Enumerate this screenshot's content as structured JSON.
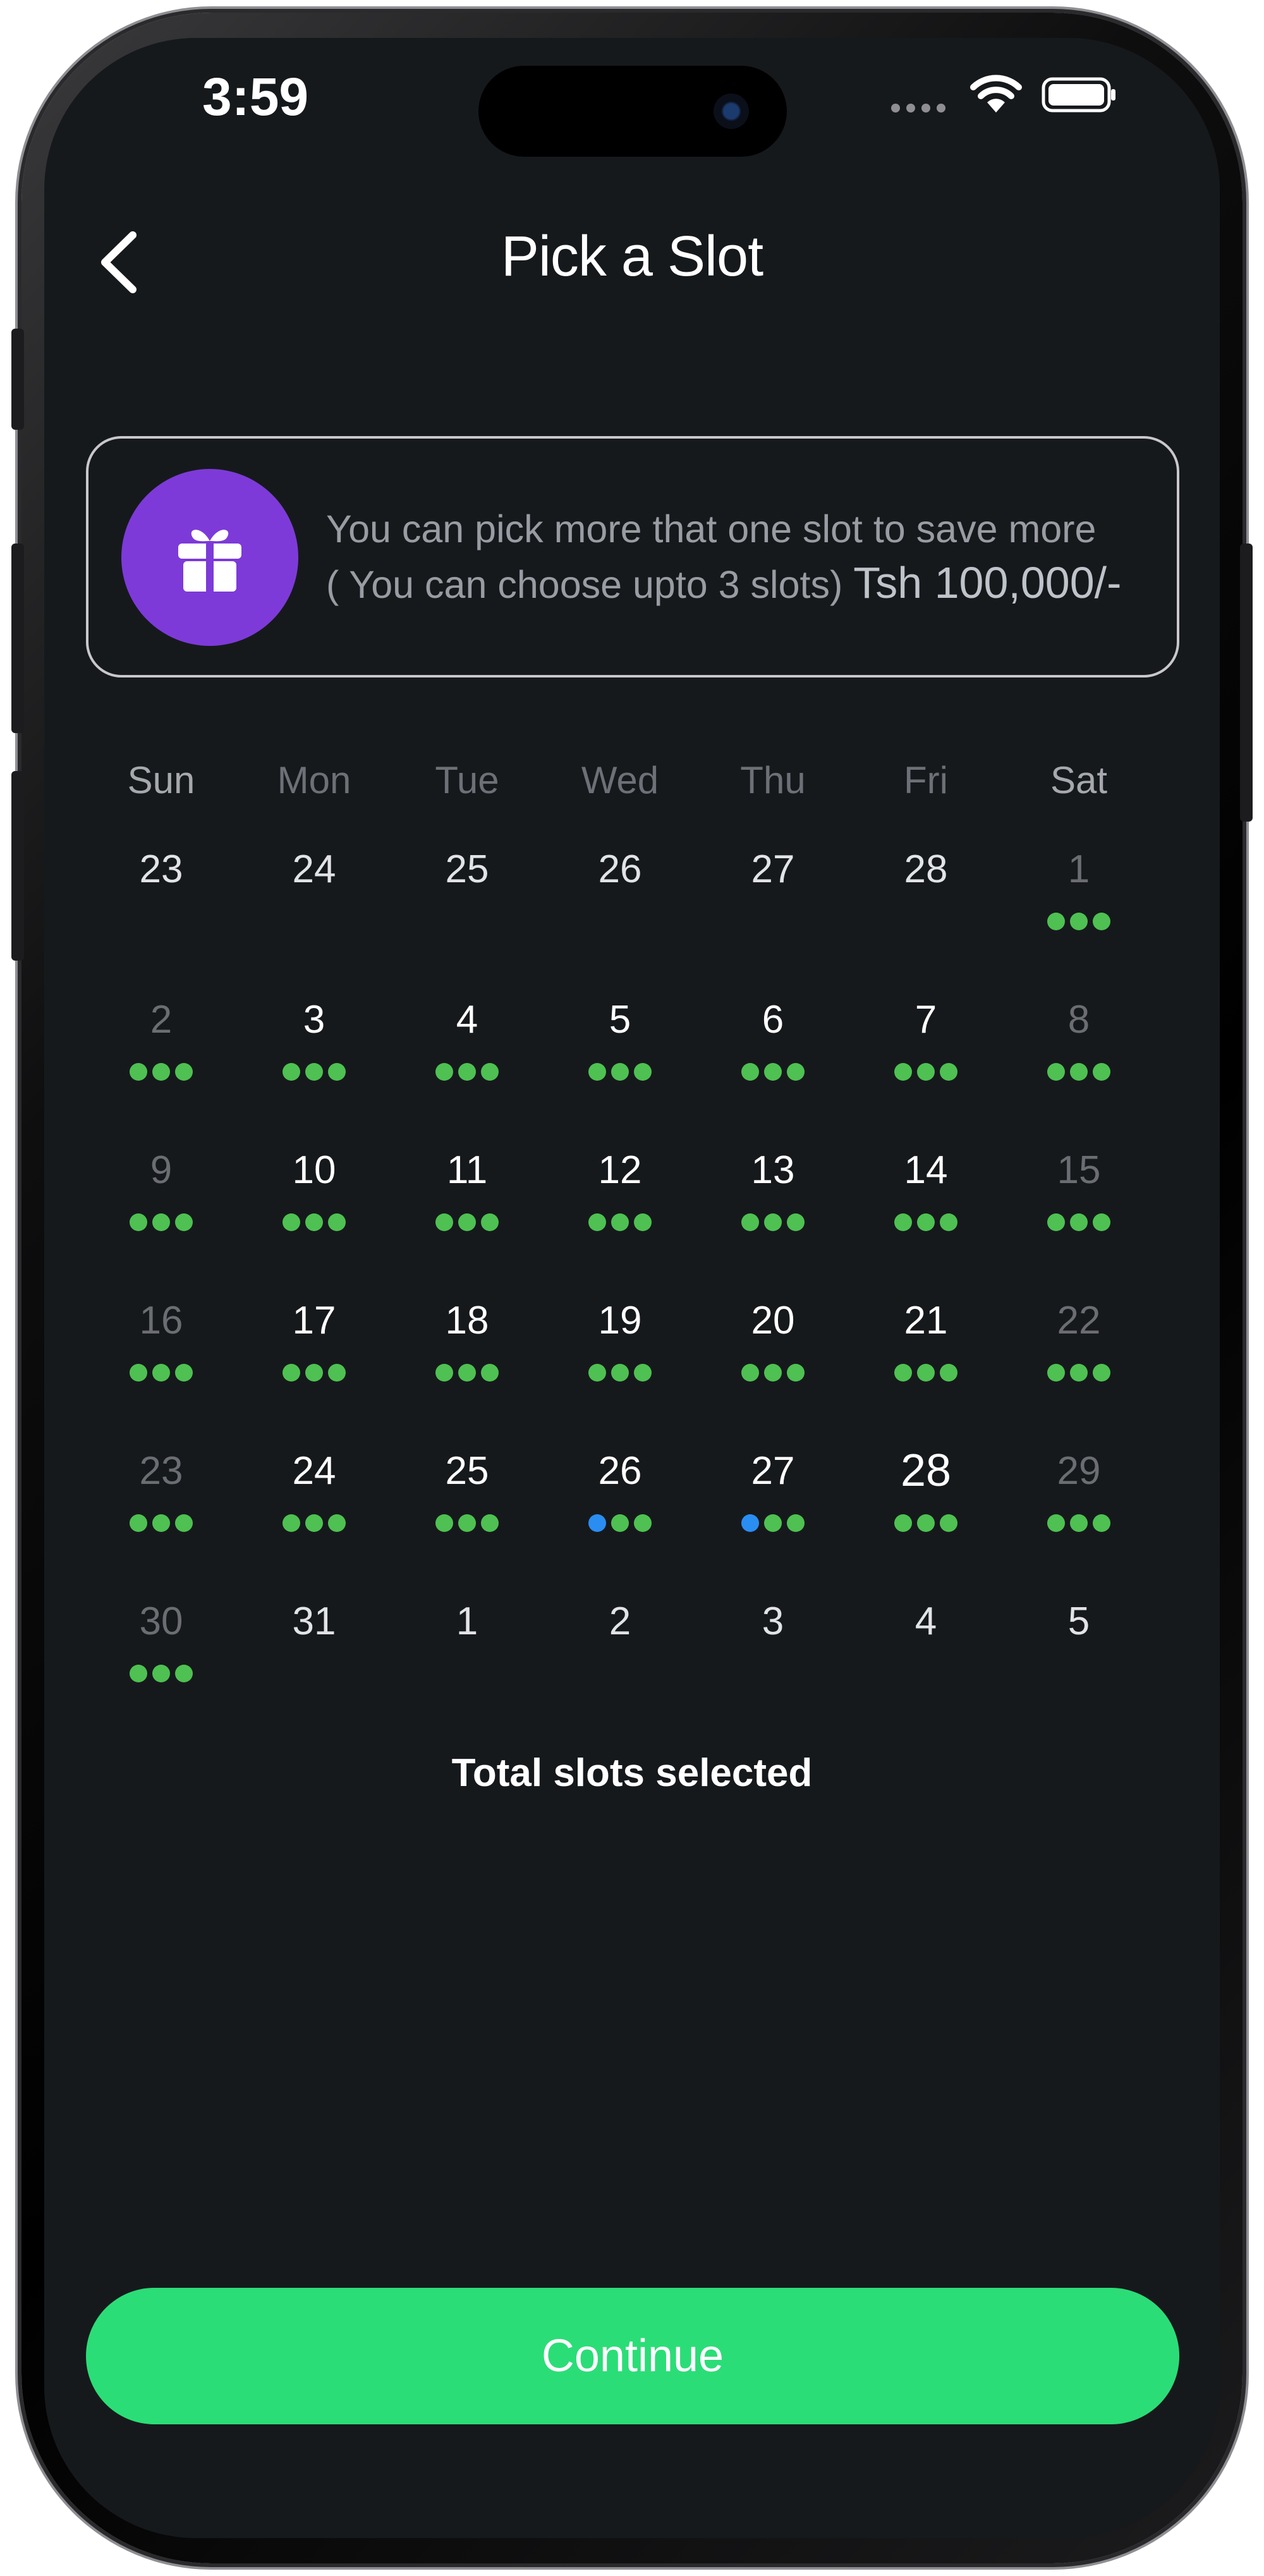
{
  "status_bar": {
    "time": "3:59"
  },
  "header": {
    "title": "Pick a Slot"
  },
  "promo": {
    "line1": "You can pick more that one slot to save more",
    "line2": "( You can choose upto 3 slots)",
    "price": "Tsh 100,000/-"
  },
  "weekdays": [
    "Sun",
    "Mon",
    "Tue",
    "Wed",
    "Thu",
    "Fri",
    "Sat"
  ],
  "calendar_rows": [
    [
      {
        "day": "23",
        "state": "plain",
        "dots": []
      },
      {
        "day": "24",
        "state": "plain",
        "dots": []
      },
      {
        "day": "25",
        "state": "plain",
        "dots": []
      },
      {
        "day": "26",
        "state": "plain",
        "dots": []
      },
      {
        "day": "27",
        "state": "plain",
        "dots": []
      },
      {
        "day": "28",
        "state": "plain",
        "dots": []
      },
      {
        "day": "1",
        "state": "dim",
        "dots": [
          "green",
          "green",
          "green"
        ]
      }
    ],
    [
      {
        "day": "2",
        "state": "dim",
        "dots": [
          "green",
          "green",
          "green"
        ]
      },
      {
        "day": "3",
        "state": "active",
        "dots": [
          "green",
          "green",
          "green"
        ]
      },
      {
        "day": "4",
        "state": "active",
        "dots": [
          "green",
          "green",
          "green"
        ]
      },
      {
        "day": "5",
        "state": "active",
        "dots": [
          "green",
          "green",
          "green"
        ]
      },
      {
        "day": "6",
        "state": "active",
        "dots": [
          "green",
          "green",
          "green"
        ]
      },
      {
        "day": "7",
        "state": "active",
        "dots": [
          "green",
          "green",
          "green"
        ]
      },
      {
        "day": "8",
        "state": "dim",
        "dots": [
          "green",
          "green",
          "green"
        ]
      }
    ],
    [
      {
        "day": "9",
        "state": "dim",
        "dots": [
          "green",
          "green",
          "green"
        ]
      },
      {
        "day": "10",
        "state": "active",
        "dots": [
          "green",
          "green",
          "green"
        ]
      },
      {
        "day": "11",
        "state": "active",
        "dots": [
          "green",
          "green",
          "green"
        ]
      },
      {
        "day": "12",
        "state": "active",
        "dots": [
          "green",
          "green",
          "green"
        ]
      },
      {
        "day": "13",
        "state": "active",
        "dots": [
          "green",
          "green",
          "green"
        ]
      },
      {
        "day": "14",
        "state": "active",
        "dots": [
          "green",
          "green",
          "green"
        ]
      },
      {
        "day": "15",
        "state": "dim",
        "dots": [
          "green",
          "green",
          "green"
        ]
      }
    ],
    [
      {
        "day": "16",
        "state": "dim",
        "dots": [
          "green",
          "green",
          "green"
        ]
      },
      {
        "day": "17",
        "state": "active",
        "dots": [
          "green",
          "green",
          "green"
        ]
      },
      {
        "day": "18",
        "state": "active",
        "dots": [
          "green",
          "green",
          "green"
        ]
      },
      {
        "day": "19",
        "state": "active",
        "dots": [
          "green",
          "green",
          "green"
        ]
      },
      {
        "day": "20",
        "state": "active",
        "dots": [
          "green",
          "green",
          "green"
        ]
      },
      {
        "day": "21",
        "state": "active",
        "dots": [
          "green",
          "green",
          "green"
        ]
      },
      {
        "day": "22",
        "state": "dim",
        "dots": [
          "green",
          "green",
          "green"
        ]
      }
    ],
    [
      {
        "day": "23",
        "state": "dim",
        "dots": [
          "green",
          "green",
          "green"
        ]
      },
      {
        "day": "24",
        "state": "active",
        "dots": [
          "green",
          "green",
          "green"
        ]
      },
      {
        "day": "25",
        "state": "active",
        "dots": [
          "green",
          "green",
          "green"
        ]
      },
      {
        "day": "26",
        "state": "active",
        "dots": [
          "blue",
          "green",
          "green"
        ]
      },
      {
        "day": "27",
        "state": "active",
        "dots": [
          "blue",
          "green",
          "green"
        ]
      },
      {
        "day": "28",
        "state": "today",
        "dots": [
          "green",
          "green",
          "green"
        ]
      },
      {
        "day": "29",
        "state": "dim",
        "dots": [
          "green",
          "green",
          "green"
        ]
      }
    ],
    [
      {
        "day": "30",
        "state": "dim",
        "dots": [
          "green",
          "green",
          "green"
        ]
      },
      {
        "day": "31",
        "state": "plain",
        "dots": []
      },
      {
        "day": "1",
        "state": "plain",
        "dots": []
      },
      {
        "day": "2",
        "state": "plain",
        "dots": []
      },
      {
        "day": "3",
        "state": "plain",
        "dots": []
      },
      {
        "day": "4",
        "state": "plain",
        "dots": []
      },
      {
        "day": "5",
        "state": "plain",
        "dots": []
      }
    ]
  ],
  "total_label": "Total slots selected",
  "continue_label": "Continue",
  "colors": {
    "background": "#16191c",
    "accent": "#2bdd77",
    "gift": "#7d3ad8",
    "dot_green": "#4ec152",
    "dot_blue": "#2a8df2"
  }
}
